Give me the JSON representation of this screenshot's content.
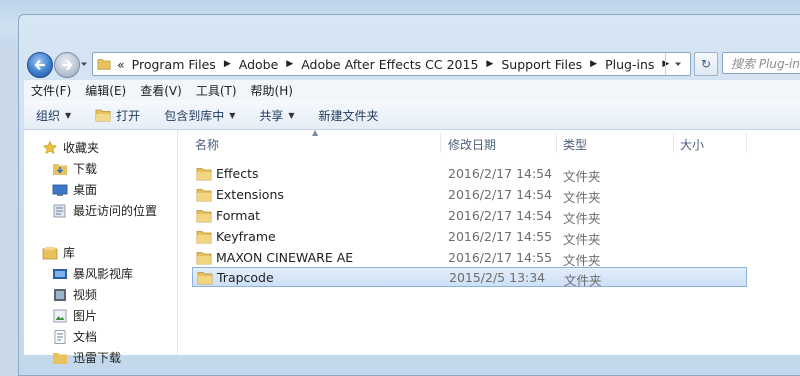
{
  "window": {
    "address": {
      "crumbs": [
        "Program Files",
        "Adobe",
        "Adobe After Effects CC 2015",
        "Support Files",
        "Plug-ins"
      ],
      "overflow_glyph": "«"
    },
    "search_placeholder": "搜索 Plug-ins",
    "refresh_glyph": "↻"
  },
  "menu": [
    "文件(F)",
    "编辑(E)",
    "查看(V)",
    "工具(T)",
    "帮助(H)"
  ],
  "toolbar": {
    "organize": "组织",
    "open": "打开",
    "include_in_library": "包含到库中",
    "share": "共享",
    "new_folder": "新建文件夹"
  },
  "navpane": {
    "favorites_header": "收藏夹",
    "favorites": [
      "下载",
      "桌面",
      "最近访问的位置"
    ],
    "libraries_header": "库",
    "libraries": [
      "暴风影视库",
      "视频",
      "图片",
      "文档",
      "迅雷下载"
    ]
  },
  "columns": {
    "name": "名称",
    "date": "修改日期",
    "type": "类型",
    "size": "大小"
  },
  "files": [
    {
      "name": "Effects",
      "date": "2016/2/17 14:54",
      "type": "文件夹",
      "selected": false
    },
    {
      "name": "Extensions",
      "date": "2016/2/17 14:54",
      "type": "文件夹",
      "selected": false
    },
    {
      "name": "Format",
      "date": "2016/2/17 14:54",
      "type": "文件夹",
      "selected": false
    },
    {
      "name": "Keyframe",
      "date": "2016/2/17 14:55",
      "type": "文件夹",
      "selected": false
    },
    {
      "name": "MAXON CINEWARE AE",
      "date": "2016/2/17 14:55",
      "type": "文件夹",
      "selected": false
    },
    {
      "name": "Trapcode",
      "date": "2015/2/5 13:34",
      "type": "文件夹",
      "selected": true
    }
  ],
  "colors": {
    "selection_fill": "#cde0f7",
    "selection_border": "#8fb2dc",
    "folder": "#e8c060"
  }
}
